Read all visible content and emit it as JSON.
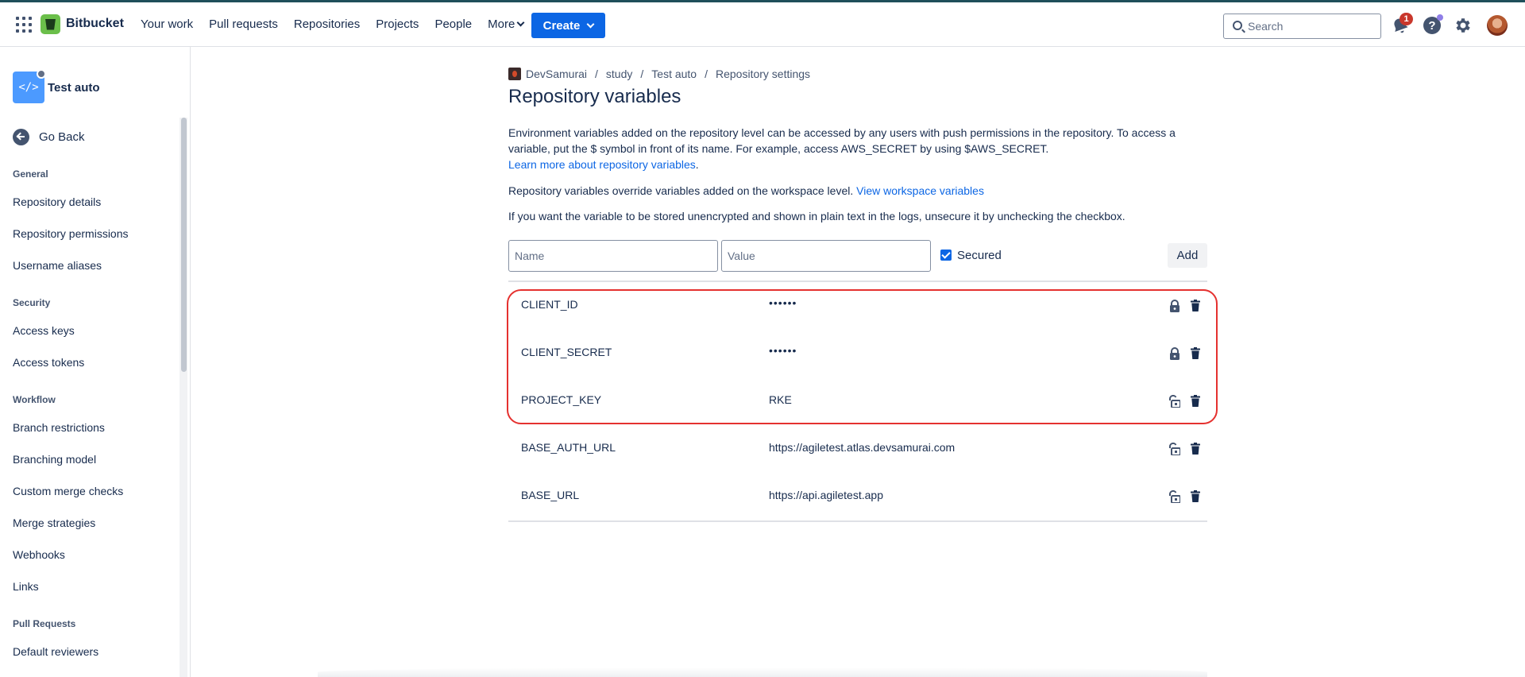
{
  "app": {
    "brand": "Bitbucket",
    "nav": [
      "Your work",
      "Pull requests",
      "Repositories",
      "Projects",
      "People"
    ],
    "more_label": "More",
    "create_label": "Create",
    "search_placeholder": "Search",
    "notification_count": "1",
    "help_label": "?"
  },
  "sidebar": {
    "repo_avatar_text": "</>",
    "repo_name": "Test auto",
    "go_back": "Go Back",
    "sections": [
      {
        "heading": "General",
        "items": [
          "Repository details",
          "Repository permissions",
          "Username aliases"
        ]
      },
      {
        "heading": "Security",
        "items": [
          "Access keys",
          "Access tokens"
        ]
      },
      {
        "heading": "Workflow",
        "items": [
          "Branch restrictions",
          "Branching model",
          "Custom merge checks",
          "Merge strategies",
          "Webhooks",
          "Links"
        ]
      },
      {
        "heading": "Pull Requests",
        "items": [
          "Default reviewers"
        ]
      }
    ]
  },
  "breadcrumb": [
    "DevSamurai",
    "study",
    "Test auto",
    "Repository settings"
  ],
  "page": {
    "title": "Repository variables",
    "intro_1": "Environment variables added on the repository level can be accessed by any users with push permissions in the repository. To access a variable, put the $ symbol in front of its name. For example, access AWS_SECRET by using $AWS_SECRET.",
    "learn_more": "Learn more about repository variables",
    "learn_more_suffix": ".",
    "intro_2": "Repository variables override variables added on the workspace level.",
    "view_workspace": "View workspace variables",
    "intro_3": "If you want the variable to be stored unencrypted and shown in plain text in the logs, unsecure it by unchecking the checkbox."
  },
  "form": {
    "name_placeholder": "Name",
    "value_placeholder": "Value",
    "secured_label": "Secured",
    "add_label": "Add"
  },
  "variables": [
    {
      "name": "CLIENT_ID",
      "value": "••••••",
      "secured": true
    },
    {
      "name": "CLIENT_SECRET",
      "value": "••••••",
      "secured": true
    },
    {
      "name": "PROJECT_KEY",
      "value": "RKE",
      "secured": false
    },
    {
      "name": "BASE_AUTH_URL",
      "value": "https://agiletest.atlas.devsamurai.com",
      "secured": false
    },
    {
      "name": "BASE_URL",
      "value": "https://api.agiletest.app",
      "secured": false
    }
  ],
  "colors": {
    "primary": "#0c66e4",
    "highlight": "#e5312f",
    "logo": "#6bbf4a"
  }
}
